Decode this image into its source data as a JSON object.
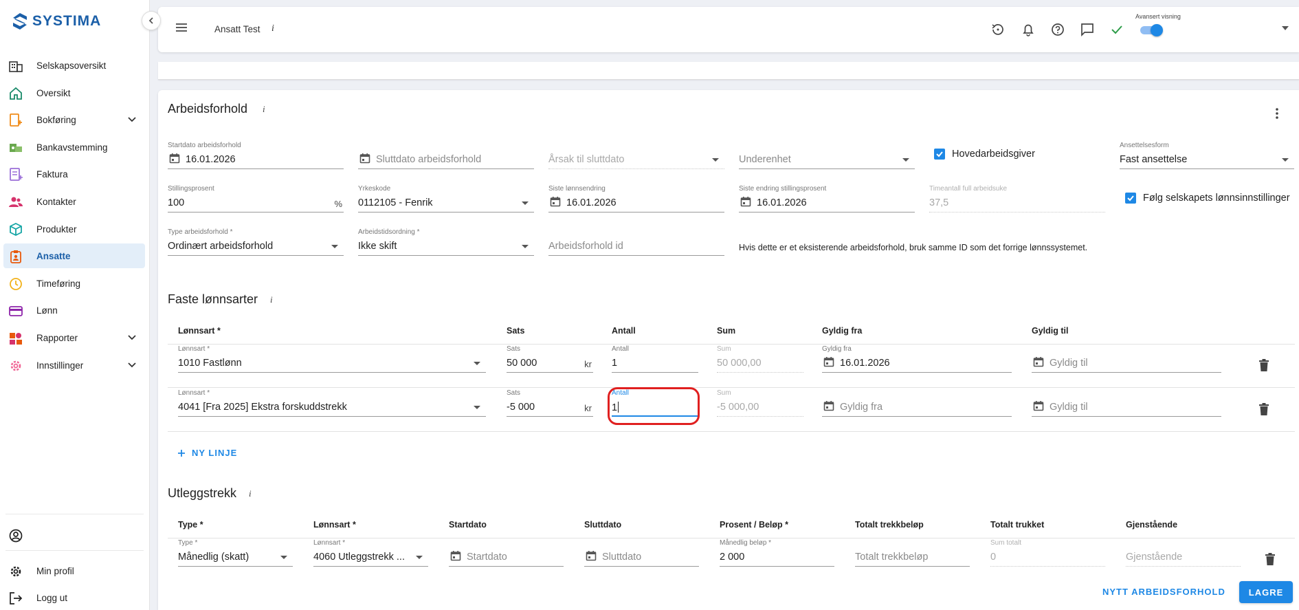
{
  "app": {
    "logo_text": "SYSTIMA"
  },
  "sidebar": {
    "items": [
      {
        "label": "Selskapsoversikt",
        "icon": "building-icon"
      },
      {
        "label": "Oversikt",
        "icon": "home-icon"
      },
      {
        "label": "Bokføring",
        "icon": "ledger-icon",
        "expandable": true
      },
      {
        "label": "Bankavstemming",
        "icon": "bank-icon"
      },
      {
        "label": "Faktura",
        "icon": "invoice-icon"
      },
      {
        "label": "Kontakter",
        "icon": "contacts-icon"
      },
      {
        "label": "Produkter",
        "icon": "box-icon"
      },
      {
        "label": "Ansatte",
        "icon": "badge-icon",
        "active": true
      },
      {
        "label": "Timeføring",
        "icon": "clock-icon"
      },
      {
        "label": "Lønn",
        "icon": "card-icon"
      },
      {
        "label": "Rapporter",
        "icon": "report-icon",
        "expandable": true
      },
      {
        "label": "Innstillinger",
        "icon": "gear-icon",
        "expandable": true
      }
    ],
    "profile_label": "Min profil",
    "logout_label": "Logg ut"
  },
  "topbar": {
    "employee_name": "Ansatt Test",
    "info_glyph": "i",
    "advanced_label": "Avansert visning",
    "advanced_on": true
  },
  "employment": {
    "title": "Arbeidsforhold",
    "start_date": {
      "label": "Startdato arbeidsforhold",
      "value": "16.01.2026"
    },
    "end_date": {
      "placeholder": "Sluttdato arbeidsforhold"
    },
    "end_reason": {
      "placeholder": "Årsak til sluttdato"
    },
    "sub_unit": {
      "placeholder": "Underenhet"
    },
    "main_employer": {
      "label": "Hovedarbeidsgiver",
      "checked": true
    },
    "employment_form": {
      "label": "Ansettelsesform",
      "value": "Fast ansettelse"
    },
    "position_percent": {
      "label": "Stillingsprosent",
      "value": "100",
      "suffix": "%"
    },
    "occupation_code": {
      "label": "Yrkeskode",
      "value": "0112105 - Fenrik"
    },
    "last_salary_change": {
      "label": "Siste lønnsendring",
      "value": "16.01.2026"
    },
    "last_percent_change": {
      "label": "Siste endring stillingsprosent",
      "value": "16.01.2026"
    },
    "hours_full_week": {
      "label": "Timeantall full arbeidsuke",
      "value": "37,5"
    },
    "follow_company": {
      "label": "Følg selskapets lønnsinnstillinger",
      "checked": true
    },
    "employment_type": {
      "label": "Type arbeidsforhold *",
      "value": "Ordinært arbeidsforhold"
    },
    "working_hours": {
      "label": "Arbeidstidsordning *",
      "value": "Ikke skift"
    },
    "employment_id": {
      "placeholder": "Arbeidsforhold id"
    },
    "helper": "Hvis dette er et eksisterende arbeidsforhold, bruk samme ID som det forrige lønnssystemet."
  },
  "fixed_wages": {
    "title": "Faste lønnsarter",
    "headers": [
      "Lønnsart *",
      "Sats",
      "Antall",
      "Sum",
      "Gyldig fra",
      "Gyldig til"
    ],
    "field_labels": {
      "wage_type": "Lønnsart *",
      "rate": "Sats",
      "quantity": "Antall",
      "sum": "Sum",
      "valid_from": "Gyldig fra",
      "valid_to": "Gyldig til"
    },
    "currency": "kr",
    "rows": [
      {
        "wage_type": "1010 Fastlønn",
        "rate": "50 000",
        "quantity": "1",
        "sum": "50 000,00",
        "valid_from": "16.01.2026",
        "valid_to": ""
      },
      {
        "wage_type": "4041 [Fra 2025] Ekstra forskuddstrekk",
        "rate": "-5 000",
        "quantity": "1",
        "sum": "-5 000,00",
        "valid_from": "",
        "valid_to": ""
      }
    ],
    "add_line_label": "NY LINJE"
  },
  "deductions": {
    "title": "Utleggstrekk",
    "headers": [
      "Type *",
      "Lønnsart *",
      "Startdato",
      "Sluttdato",
      "Prosent / Beløp *",
      "Totalt trekkbeløp",
      "Totalt trukket",
      "Gjenstående"
    ],
    "row": {
      "type_label": "Type *",
      "type": "Månedlig (skatt)",
      "wage_label": "Lønnsart *",
      "wage": "4060 Utleggstrekk ...",
      "start_placeholder": "Startdato",
      "end_placeholder": "Sluttdato",
      "amount_label": "Månedlig beløp *",
      "amount": "2 000",
      "total_placeholder": "Totalt trekkbeløp",
      "deducted_label": "Sum totalt",
      "deducted": "0",
      "remaining_placeholder": "Gjenstående"
    }
  },
  "actions": {
    "new_employment": "NYTT ARBEIDSFORHOLD",
    "save": "LAGRE"
  },
  "colors": {
    "accent": "#1e88e5",
    "brand": "#1b5fa8",
    "highlight": "#e02020",
    "active_bg": "#e3eef9"
  }
}
